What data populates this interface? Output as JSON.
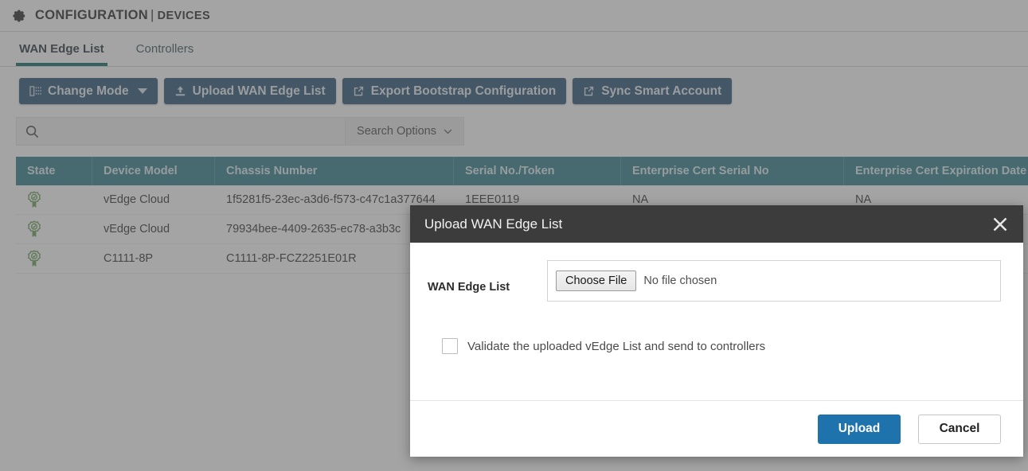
{
  "header": {
    "gear_icon": "gear-icon",
    "title": "CONFIGURATION",
    "separator": "|",
    "subtitle": "DEVICES"
  },
  "tabs": [
    {
      "label": "WAN Edge List",
      "active": true
    },
    {
      "label": "Controllers",
      "active": false
    }
  ],
  "toolbar": {
    "change_mode_label": "Change Mode",
    "upload_wan_edge_list_label": "Upload WAN Edge List",
    "export_bootstrap_label": "Export Bootstrap Configuration",
    "sync_smart_account_label": "Sync Smart Account"
  },
  "search": {
    "value": "",
    "placeholder": "",
    "options_label": "Search Options",
    "search_icon": "search-icon",
    "chevron_icon": "chevron-down-icon"
  },
  "table": {
    "columns": [
      "State",
      "Device Model",
      "Chassis Number",
      "Serial No./Token",
      "Enterprise Cert Serial No",
      "Enterprise Cert Expiration Date"
    ],
    "rows": [
      {
        "state_icon": "certificate-valid-icon",
        "device_model": "vEdge Cloud",
        "chassis_number": "1f5281f5-23ec-a3d6-f573-c47c1a377644",
        "serial_no": "1EEE0119",
        "enterprise_cert_serial_no": "NA",
        "enterprise_cert_expiration_date": "NA"
      },
      {
        "state_icon": "certificate-valid-icon",
        "device_model": "vEdge Cloud",
        "chassis_number": "79934bee-4409-2635-ec78-a3b3c",
        "serial_no": "",
        "enterprise_cert_serial_no": "",
        "enterprise_cert_expiration_date": ""
      },
      {
        "state_icon": "certificate-valid-icon",
        "device_model": "C1111-8P",
        "chassis_number": "C1111-8P-FCZ2251E01R",
        "serial_no": "",
        "enterprise_cert_serial_no": "",
        "enterprise_cert_expiration_date": ""
      }
    ]
  },
  "modal": {
    "title": "Upload WAN Edge List",
    "close_icon": "close-icon",
    "file_field_label": "WAN Edge List",
    "choose_file_label": "Choose File",
    "file_status": "No file chosen",
    "checkbox_label": "Validate the uploaded vEdge List and send to controllers",
    "checkbox_checked": false,
    "upload_label": "Upload",
    "cancel_label": "Cancel"
  },
  "colors": {
    "accent_teal": "#0d6b6b",
    "table_header": "#2f7f8c",
    "button_primary": "#2a5578",
    "upload_button": "#1f73ad",
    "modal_header": "#3c3c3c",
    "state_icon_green": "#68a05a"
  }
}
